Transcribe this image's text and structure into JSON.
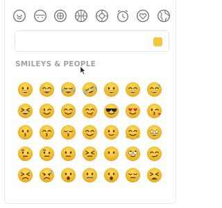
{
  "colors": {
    "face": "#f7c635",
    "face_shade": "#e9a81f",
    "feature": "#5a3a1a",
    "icon_stroke": "#7a7a7a",
    "swatch": "#f5c53a",
    "section_title": "#a3a3a3"
  },
  "categories": [
    {
      "icon": "smiley-face-icon",
      "name": "Smileys & People"
    },
    {
      "icon": "animal-face-icon",
      "name": "Animals & Nature"
    },
    {
      "icon": "food-icon",
      "name": "Food & Drink"
    },
    {
      "icon": "activity-icon",
      "name": "Activity"
    },
    {
      "icon": "travel-icon",
      "name": "Travel & Places"
    },
    {
      "icon": "objects-clock-icon",
      "name": "Objects"
    },
    {
      "icon": "symbols-heart-icon",
      "name": "Symbols"
    },
    {
      "icon": "flags-globe-icon",
      "name": "Flags"
    }
  ],
  "search": {
    "value": "",
    "placeholder": ""
  },
  "section": {
    "title": "SMILEYS & PEOPLE"
  },
  "emojis": [
    "grinning-face",
    "grinning-face-big-eyes",
    "face-with-tears-of-joy",
    "rolling-on-floor-laughing",
    "grinning-face-smiling-eyes",
    "beaming-face",
    "grinning-sweat",
    "grinning-squinting-face",
    "winking-face",
    "smiling-face-smiling-eyes",
    "face-savoring-food",
    "smiling-face-with-sunglasses",
    "heart-eyes",
    "face-blowing-kiss",
    "kissing-face",
    "kissing-smiling-eyes",
    "kissing-closed-eyes",
    "smiling-face",
    "slightly-smiling-face",
    "hugging-face",
    "star-struck",
    "thinking-face",
    "face-raised-eyebrow",
    "neutral-face",
    "expressionless-face",
    "face-without-mouth",
    "face-rolling-eyes",
    "smirking-face",
    "persevering-face",
    "sad-but-relieved",
    "hushed-face",
    "zipper-mouth-face",
    "face-open-mouth",
    "sleepy-face",
    "tired-face"
  ]
}
